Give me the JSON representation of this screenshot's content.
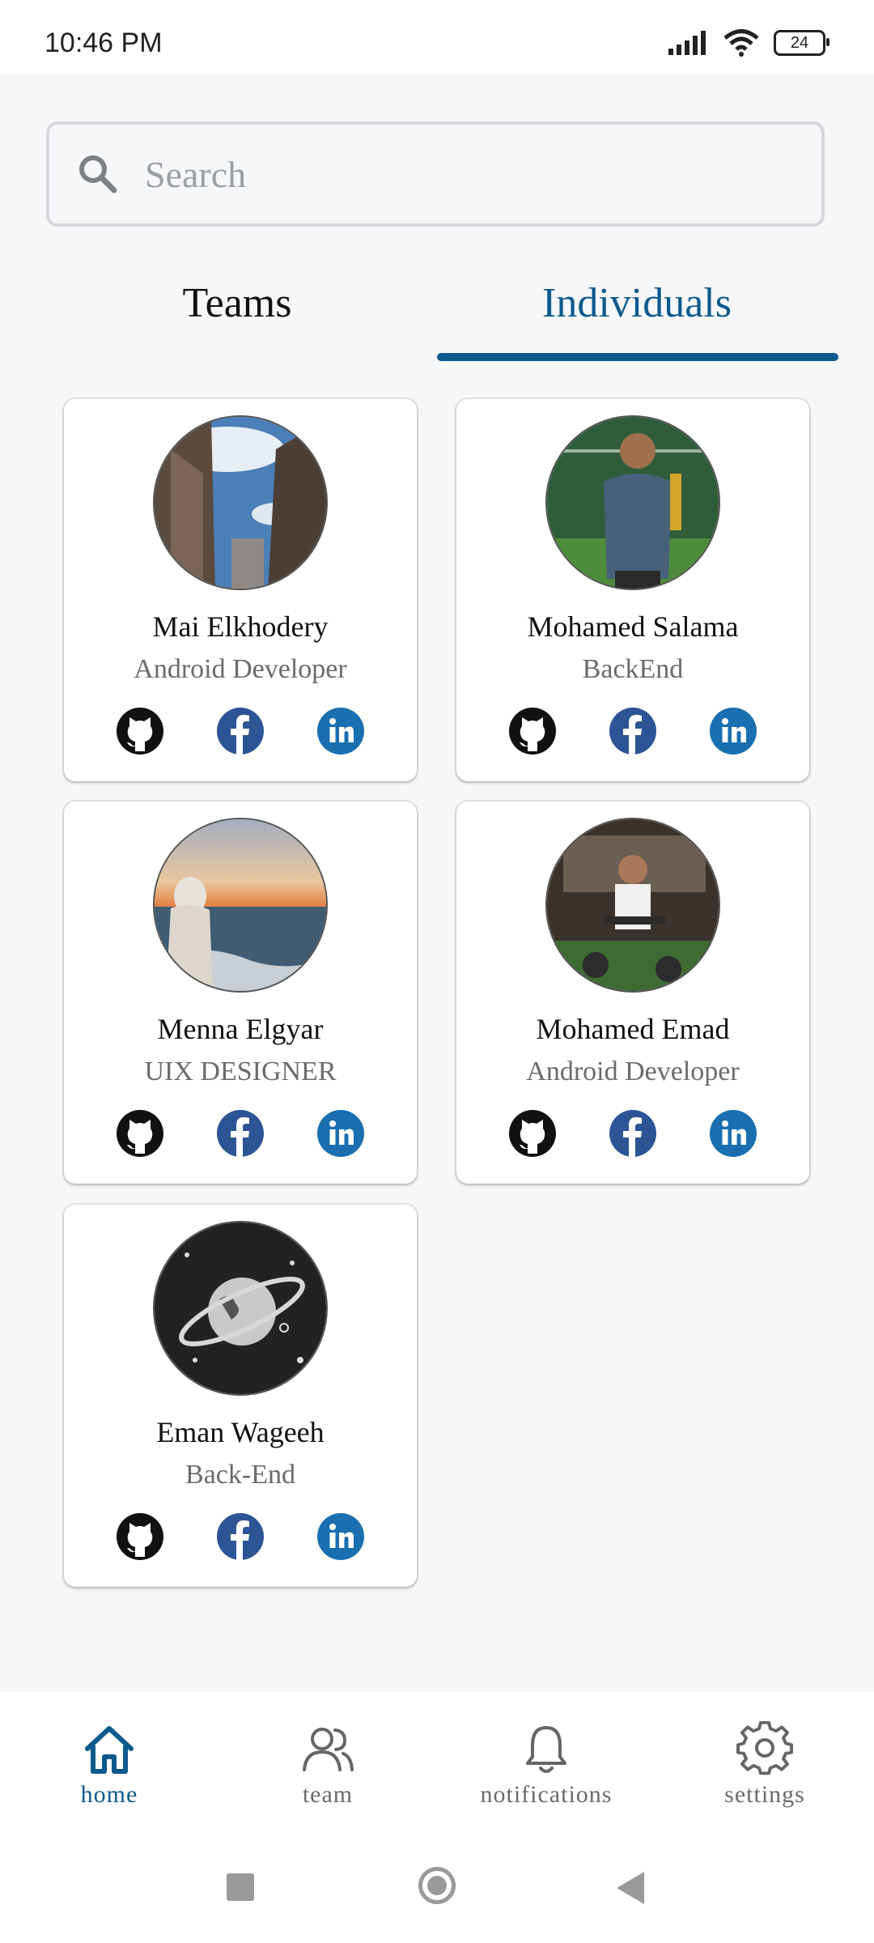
{
  "status_bar": {
    "time": "10:46 PM",
    "battery": "24"
  },
  "search": {
    "placeholder": "Search",
    "value": ""
  },
  "tabs": [
    {
      "label": "Teams",
      "selected": false
    },
    {
      "label": "Individuals",
      "selected": true
    }
  ],
  "people": [
    {
      "name": "Mai Elkhodery",
      "role": "Android Developer",
      "avatar": "city-street-sky-photo"
    },
    {
      "name": "Mohamed Salama",
      "role": "BackEnd",
      "avatar": "man-holding-trophy-photo"
    },
    {
      "name": "Menna Elgyar",
      "role": "UIX DESIGNER",
      "avatar": "woman-at-sea-sunset-photo"
    },
    {
      "name": "Mohamed Emad",
      "role": "Android Developer",
      "avatar": "man-in-gym-photo"
    },
    {
      "name": "Eman Wageeh",
      "role": "Back-End",
      "avatar": "planet-space-illustration"
    }
  ],
  "bottom_nav": [
    {
      "label": "home",
      "icon": "home-icon",
      "active": true
    },
    {
      "label": "team",
      "icon": "team-icon",
      "active": false
    },
    {
      "label": "notifications",
      "icon": "bell-icon",
      "active": false
    },
    {
      "label": "settings",
      "icon": "gear-icon",
      "active": false
    }
  ],
  "colors": {
    "accent": "#0d5a8c",
    "facebook": "#2d5596",
    "linkedin": "#1a6fb0",
    "github": "#111111",
    "background": "#f6f7f9"
  }
}
